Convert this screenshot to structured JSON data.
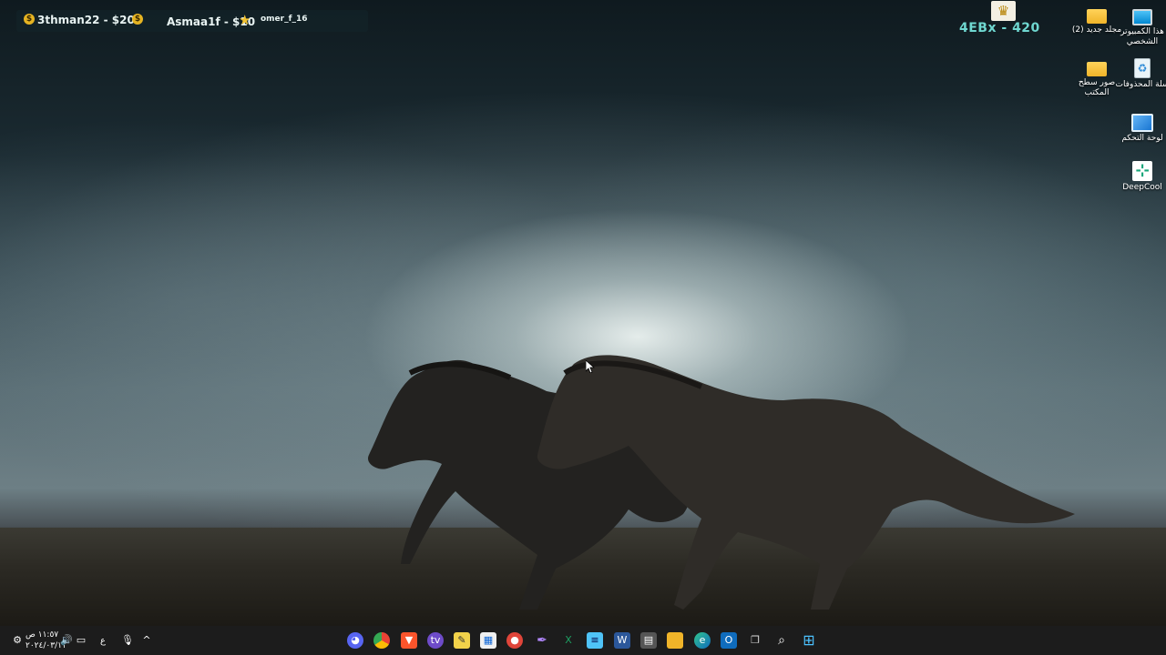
{
  "overlay": {
    "ticker": [
      {
        "user": "3thman22 - $200"
      },
      {
        "user": "Asmaa1f - $10"
      }
    ],
    "sub_user": "omer_f_16",
    "points": "4EBx - 420"
  },
  "desktop_icons": [
    {
      "label": "هذا الكمبيوتر الشخصي",
      "icon": "monitor-icon"
    },
    {
      "label": "مجلد جديد (2)",
      "icon": "folder-icon"
    },
    {
      "label": "سلة المحذوفات",
      "icon": "recycle-bin-icon"
    },
    {
      "label": "صور سطح المكتب",
      "icon": "folder-icon"
    },
    {
      "label": "لوحة التحكم",
      "icon": "control-panel-icon"
    },
    {
      "label": "DeepCool",
      "icon": "deepcool-icon"
    }
  ],
  "taskbar": {
    "time": "١١:٥٧ ص",
    "date": "٢٠٢٤/٠٣/١١",
    "lang": "ع",
    "apps": [
      "discord-icon",
      "chrome-icon",
      "brave-icon",
      "twitch-icon",
      "notes-icon",
      "store-icon",
      "capture-icon",
      "feather-icon",
      "excel-icon",
      "notepad-icon",
      "word-icon",
      "calculator-icon",
      "file-explorer-icon",
      "edge-icon",
      "outlook-icon",
      "task-view-icon",
      "search-icon",
      "start-icon"
    ]
  },
  "colors": {
    "accent": "#6fd7d0",
    "taskbar": "#1c1c1c"
  }
}
